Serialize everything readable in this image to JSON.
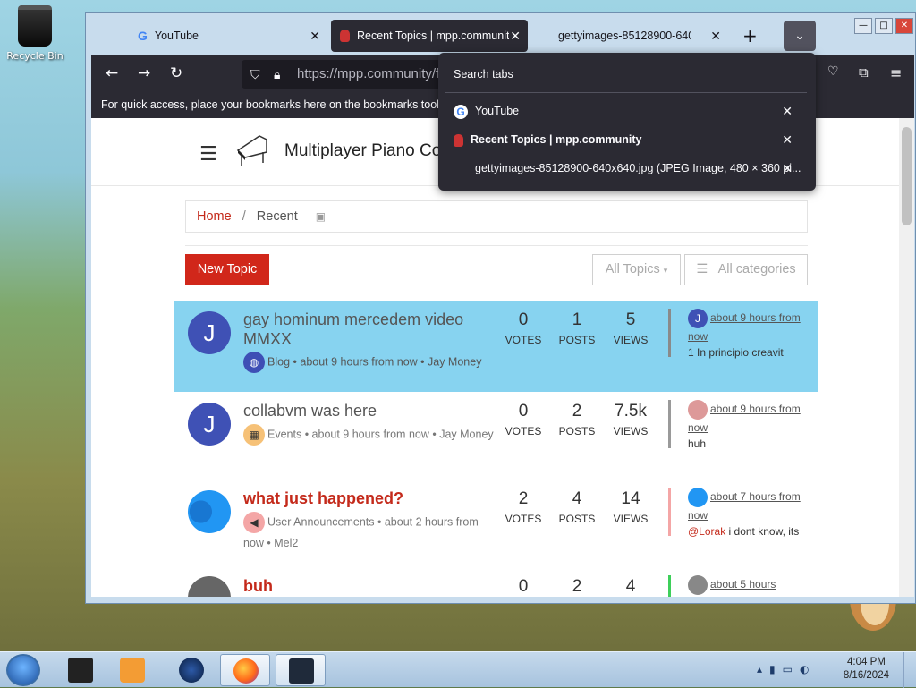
{
  "desktop": {
    "recycle_bin_label": "Recycle Bin"
  },
  "window": {
    "buttons": {
      "minimize": "—",
      "maximize": "□",
      "close": "✕"
    }
  },
  "tabs": [
    {
      "title": "YouTube",
      "icon": "google-icon",
      "active": false
    },
    {
      "title": "Recent Topics | mpp.communit",
      "icon": "mpp-icon",
      "active": true
    },
    {
      "title": "gettyimages-85128900-640x640",
      "icon": "image-icon",
      "active": false
    }
  ],
  "toolbar": {
    "new_tab": "+",
    "list_tabs": "⌄",
    "url": "https://mpp.community/fo",
    "bookmarks_hint": "For quick access, place your bookmarks here on the bookmarks toolbar."
  },
  "tab_search": {
    "title": "Search tabs",
    "items": [
      {
        "title": "YouTube",
        "bold": false
      },
      {
        "title": "Recent Topics | mpp.community",
        "bold": true
      },
      {
        "title": "gettyimages-85128900-640x640.jpg (JPEG Image, 480 × 360 pi...",
        "bold": false
      }
    ]
  },
  "page": {
    "site_name": "Multiplayer Piano Co",
    "breadcrumb": {
      "home": "Home",
      "separator": "/",
      "current": "Recent"
    },
    "new_topic_label": "New Topic",
    "filter_topics_label": "All Topics",
    "filter_categories_label": "All categories",
    "stat_labels": {
      "votes": "VOTES",
      "posts": "POSTS",
      "views": "VIEWS"
    },
    "topics": [
      {
        "avatar_letter": "J",
        "title": "gay hominum mercedem video MMXX",
        "category": "Blog",
        "meta": "• about 9 hours from now • Jay Money",
        "votes": "0",
        "posts": "1",
        "views": "5",
        "teaser_avatar": "J",
        "teaser_when": "about 9 hours from now",
        "teaser_text": "1 In principio creavit",
        "highlighted": true
      },
      {
        "avatar_letter": "J",
        "title": "collabvm was here",
        "category": "Events",
        "meta": "• about 9 hours from now • Jay Money",
        "votes": "0",
        "posts": "2",
        "views": "7.5k",
        "teaser_avatar": "",
        "teaser_when": "about 9 hours from now",
        "teaser_text": "huh",
        "highlighted": false
      },
      {
        "avatar_letter": "",
        "title": "what just happened?",
        "category": "User Announcements",
        "meta": "• about 2 hours from now • Mel2",
        "votes": "2",
        "posts": "4",
        "views": "14",
        "teaser_avatar": "",
        "teaser_when": "about 7 hours from now",
        "teaser_mention": "@Lorak",
        "teaser_text": " i dont know, its",
        "highlighted": false
      },
      {
        "avatar_letter": "",
        "title": "buh",
        "category": "",
        "meta": "",
        "votes": "0",
        "posts": "2",
        "views": "4",
        "teaser_avatar": "",
        "teaser_when": "about 5 hours",
        "teaser_text": "",
        "highlighted": false
      }
    ]
  },
  "taskbar": {
    "time": "4:04 PM",
    "date": "8/16/2024"
  }
}
